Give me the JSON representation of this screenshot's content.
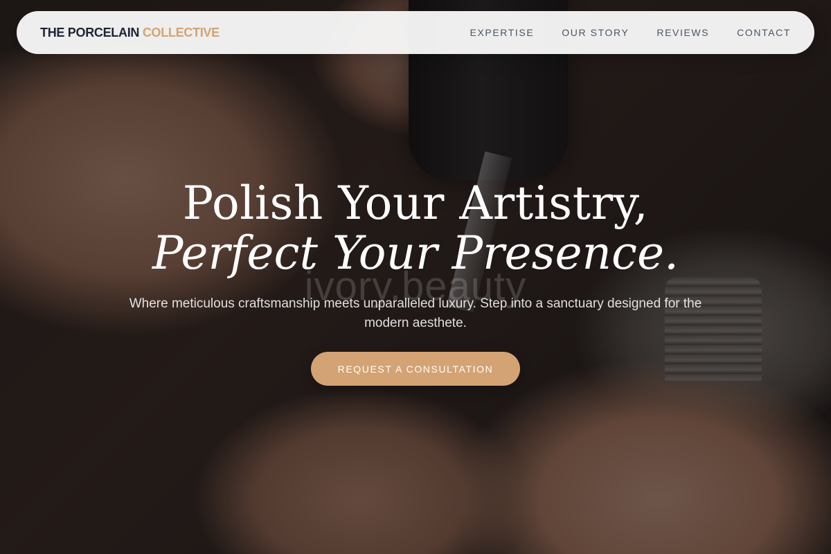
{
  "nav": {
    "brand_primary": "THE PORCELAIN",
    "brand_accent": "COLLECTIVE",
    "links": [
      {
        "label": "EXPERTISE"
      },
      {
        "label": "OUR STORY"
      },
      {
        "label": "REVIEWS"
      },
      {
        "label": "CONTACT"
      }
    ]
  },
  "hero": {
    "headline_line1": "Polish Your Artistry,",
    "headline_line2": "Perfect Your Presence.",
    "watermark": "ivory.beauty",
    "subtext": "Where meticulous craftsmanship meets unparalleled luxury. Step into a sanctuary designed for the modern aesthete.",
    "cta_label": "REQUEST A CONSULTATION"
  },
  "colors": {
    "accent": "#d4a373",
    "brand_dark": "#1e2433",
    "nav_link": "#4b5563",
    "nav_bg": "#fafafa"
  }
}
